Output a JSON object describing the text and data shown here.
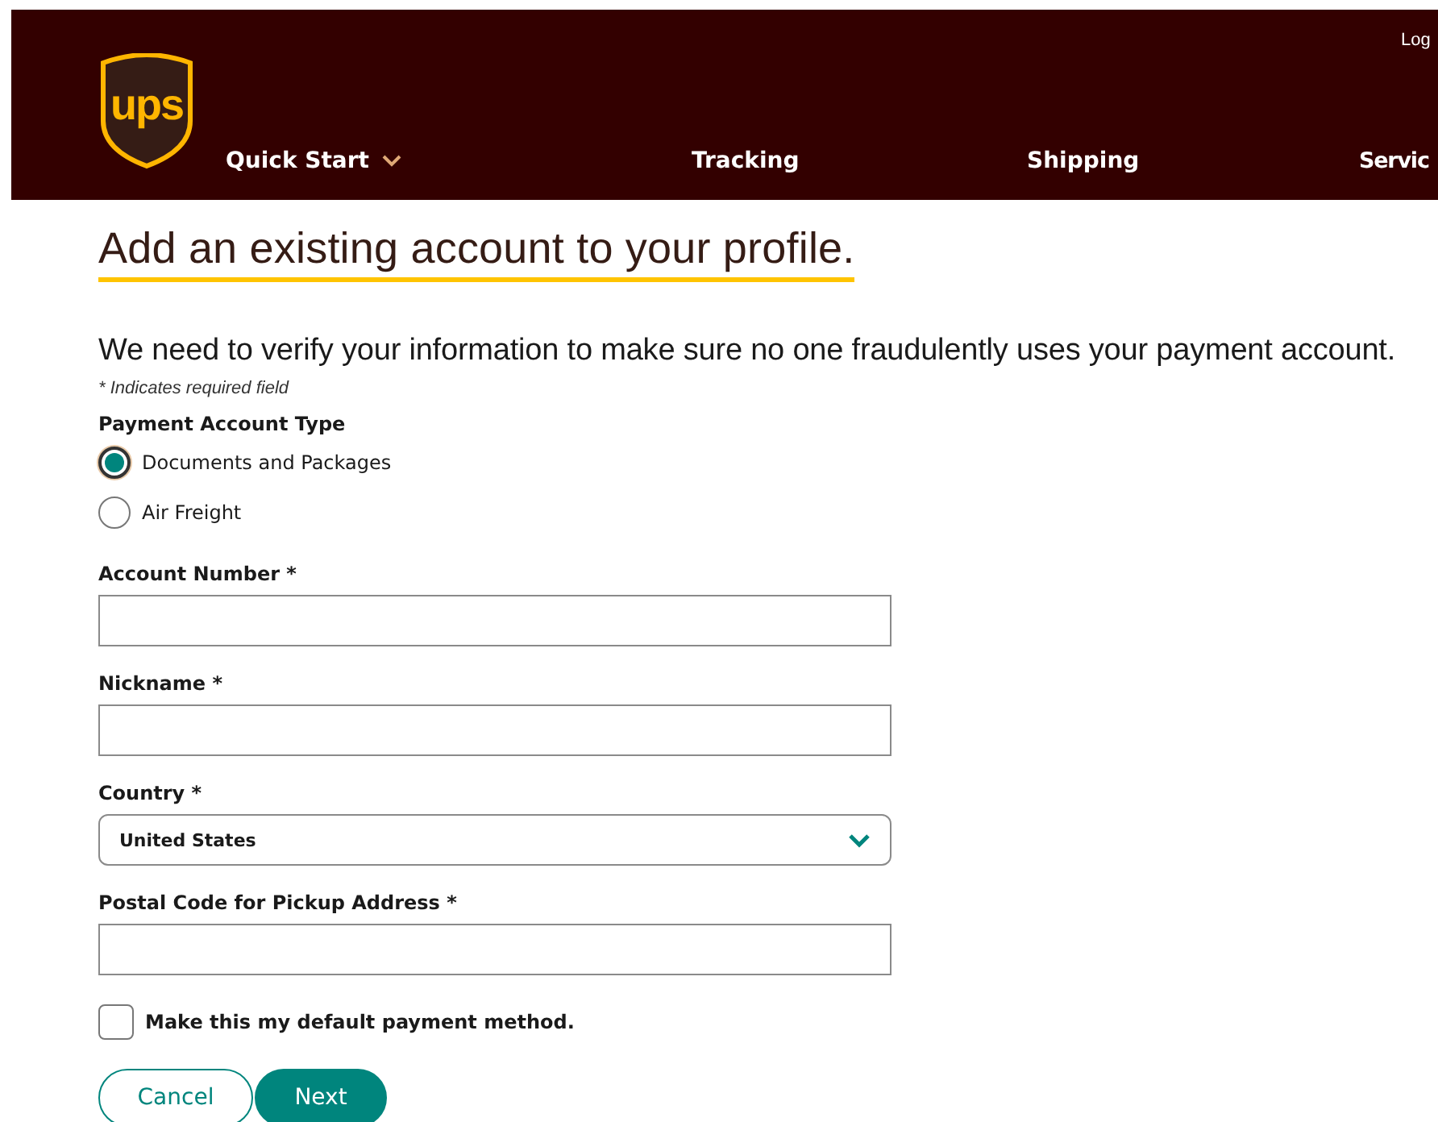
{
  "header": {
    "logo": "ups",
    "login": "Log",
    "nav": [
      {
        "label": "Quick Start",
        "dropdown": true
      },
      {
        "label": "Tracking",
        "dropdown": false
      },
      {
        "label": "Shipping",
        "dropdown": false
      },
      {
        "label": "Servic",
        "dropdown": false
      }
    ]
  },
  "page": {
    "title": "Add an existing account to your profile.",
    "intro": "We need to verify your information to make sure no one fraudulently uses your payment account.",
    "required_note": "* Indicates required field"
  },
  "payment_type": {
    "label": "Payment Account Type",
    "options": [
      {
        "label": "Documents and Packages",
        "selected": true
      },
      {
        "label": "Air Freight",
        "selected": false
      }
    ]
  },
  "fields": [
    {
      "kind": "text",
      "label": "Account Number *"
    },
    {
      "kind": "text",
      "label": "Nickname *"
    },
    {
      "kind": "select",
      "label": "Country *",
      "value": "United States"
    },
    {
      "kind": "text",
      "label": "Postal Code for Pickup Address *"
    }
  ],
  "default_checkbox": {
    "label": "Make this my default payment method.",
    "checked": false
  },
  "buttons": [
    {
      "kind": "secondary",
      "label": "Cancel"
    },
    {
      "kind": "primary",
      "label": "Next"
    }
  ]
}
